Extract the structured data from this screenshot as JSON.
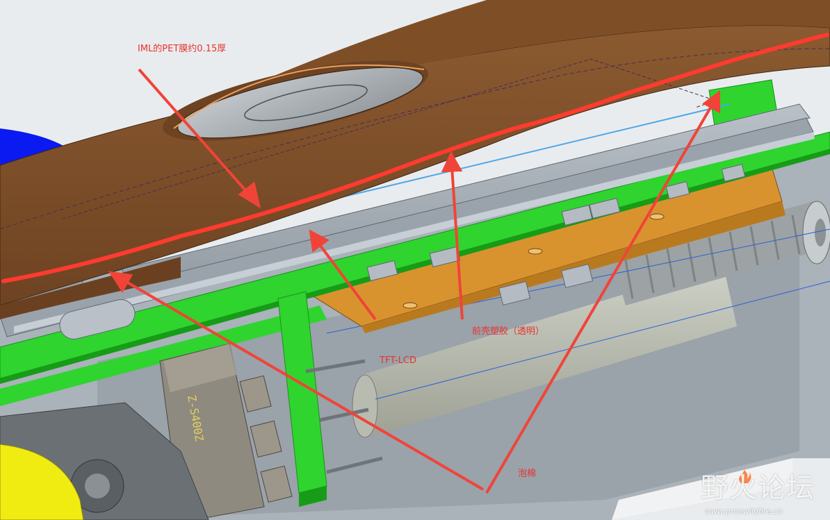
{
  "annotations": {
    "iml": "IML的PET膜约0.15厚",
    "tft": "TFT-LCD",
    "front_shell": "前壳塑胶（透明）",
    "foam": "泡棉"
  },
  "watermark": {
    "title": "野火论坛",
    "url": "www.proewildfire.cn"
  },
  "colors": {
    "annotation": "#e8332e",
    "housing_brown": "#7c4e2a",
    "pcb_green": "#2fd42f",
    "bracket_orange": "#d9932e",
    "body_gray": "#a6afb8",
    "background": "#e9ecef"
  }
}
